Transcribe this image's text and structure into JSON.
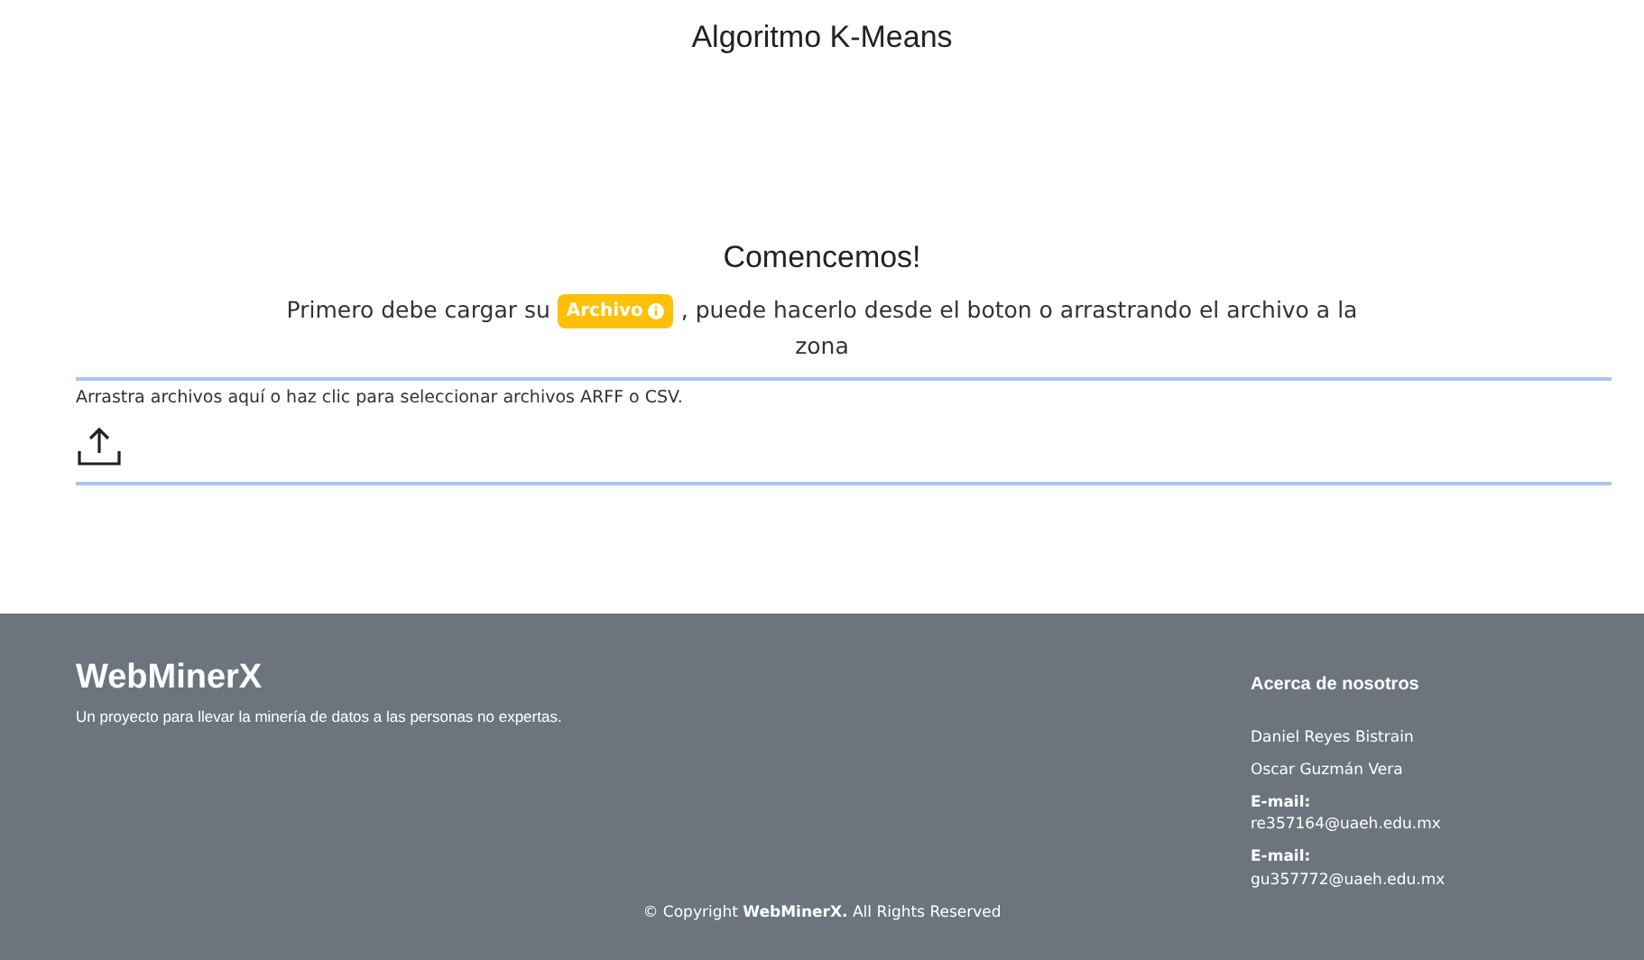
{
  "page_title": "Algoritmo K-Means",
  "intro": {
    "heading": "Comencemos!",
    "text_before": "Primero debe cargar su",
    "badge": "Archivo",
    "text_after": ", puede hacerlo desde el boton o arrastrando el archivo a la zona"
  },
  "dropzone": {
    "message": "Arrastra archivos aquí o haz clic para seleccionar archivos ARFF o CSV."
  },
  "footer": {
    "brand": "WebMinerX",
    "tagline": "Un proyecto para llevar la minería de datos a las personas no expertas.",
    "about_heading": "Acerca de nosotros",
    "about_lines": [
      "Daniel Reyes Bistrain",
      "Oscar Guzmán Vera",
      "**E-mail:** re357164@uaeh.edu.mx",
      "**E-mail:** gu357772@uaeh.edu.mx"
    ],
    "copyright": "© Copyright **WebMinerX.** All Rights Reserved"
  }
}
